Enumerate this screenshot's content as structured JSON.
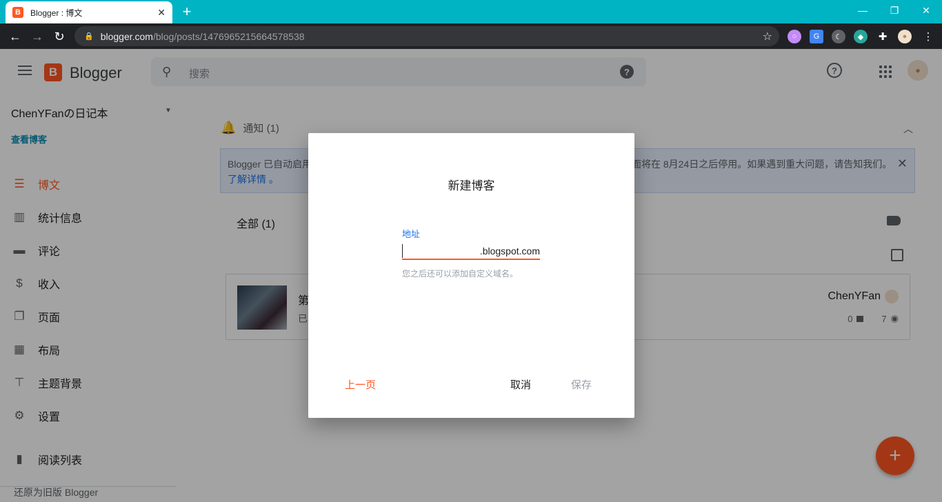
{
  "browser": {
    "tab_title": "Blogger : 博文",
    "tab_favicon": "B",
    "url_host": "blogger.com",
    "url_path": "/blog/posts/1476965215664578538"
  },
  "appbar": {
    "logo_letter": "B",
    "app_name": "Blogger",
    "search_placeholder": "搜索"
  },
  "sidebar": {
    "blog_name": "ChenYFanの日记本",
    "view_blog": "查看博客",
    "items": [
      {
        "label": "博文",
        "icon": "posts-icon",
        "active": true
      },
      {
        "label": "统计信息",
        "icon": "stats-icon"
      },
      {
        "label": "评论",
        "icon": "comments-icon"
      },
      {
        "label": "收入",
        "icon": "earnings-icon"
      },
      {
        "label": "页面",
        "icon": "pages-icon"
      },
      {
        "label": "布局",
        "icon": "layout-icon"
      },
      {
        "label": "主题背景",
        "icon": "theme-icon"
      },
      {
        "label": "设置",
        "icon": "settings-icon"
      }
    ],
    "reading_list": "阅读列表",
    "revert": "还原为旧版 Blogger"
  },
  "main": {
    "notifications_label": "通知 (1)",
    "banner_text": "Blogger 已自动启用",
    "banner_text_right": "面将在 8月24日之后停用。如果遇到重大问题，请告知我们。",
    "banner_link": "了解详情",
    "banner_link_suffix": "。",
    "filter_label": "全部 (1)",
    "post": {
      "title_fragment": "第",
      "status_fragment": "已",
      "author": "ChenYFan",
      "comments": "0",
      "views": "7"
    }
  },
  "dialog": {
    "title": "新建博客",
    "field_label": "地址",
    "field_value": "",
    "field_suffix": ".blogspot.com",
    "field_hint": "您之后还可以添加自定义域名。",
    "btn_prev": "上一页",
    "btn_cancel": "取消",
    "btn_save": "保存"
  },
  "colors": {
    "accent": "#ff5722",
    "browser_frame": "#00b4c4",
    "link": "#1a73e8"
  }
}
